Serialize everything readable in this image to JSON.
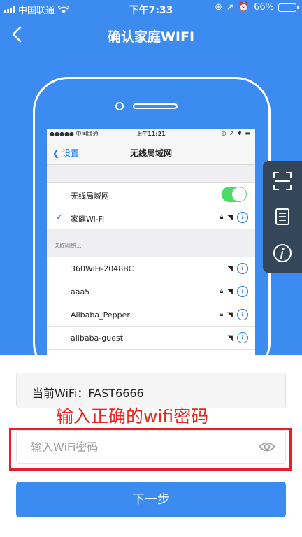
{
  "status_bar": {
    "carrier": "中国联通",
    "time": "下午7:33",
    "battery": "66%"
  },
  "nav": {
    "title": "确认家庭WIFI"
  },
  "illustration": {
    "status_carrier": "●●●●● 中国联通",
    "status_time": "上午11:21",
    "status_icons": "◎ ↗ ✱ ▬",
    "back_label": "设置",
    "title": "无线局域网",
    "wlan_label": "无线局域网",
    "connected_network": "家庭Wi-Fi",
    "section_label": "选取网络...",
    "networks": [
      {
        "name": "360WiFi-2048BC"
      },
      {
        "name": "aaa5"
      },
      {
        "name": "Alibaba_Pepper"
      },
      {
        "name": "alibaba-guest"
      }
    ]
  },
  "side_panel": {
    "icons": [
      "scan-icon",
      "document-icon",
      "info-icon"
    ]
  },
  "form": {
    "current_wifi": "当前WiFi：FAST6666",
    "hint": "输入正确的wifi密码",
    "password_value": "",
    "password_placeholder": "输入WiFi密码",
    "next_label": "下一步"
  },
  "colors": {
    "primary": "#3b8bf0",
    "alert_red": "#e4202a",
    "panel": "#34465a",
    "toggle_on": "#4cd964"
  }
}
